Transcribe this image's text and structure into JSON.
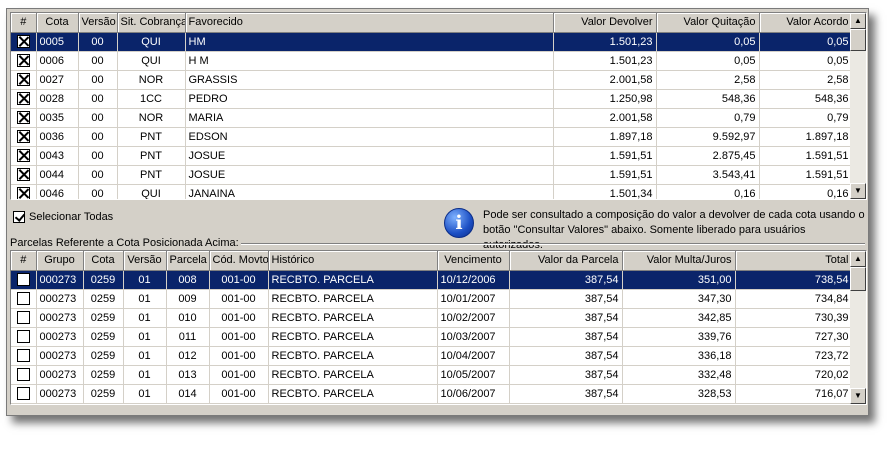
{
  "top_grid": {
    "columns": [
      "#",
      "Cota",
      "Versão",
      "Sit. Cobrança",
      "Favorecido",
      "Valor Devolver",
      "Valor Quitação",
      "Valor Acordo"
    ],
    "rows": [
      {
        "cota": "0005",
        "versao": "00",
        "sit": "QUI",
        "favorecido": "HM",
        "devolver": "1.501,23",
        "quitacao": "0,05",
        "acordo": "0,05",
        "checked": true,
        "selected": true
      },
      {
        "cota": "0006",
        "versao": "00",
        "sit": "QUI",
        "favorecido": "H M",
        "devolver": "1.501,23",
        "quitacao": "0,05",
        "acordo": "0,05",
        "checked": true
      },
      {
        "cota": "0027",
        "versao": "00",
        "sit": "NOR",
        "favorecido": "GRASSIS",
        "devolver": "2.001,58",
        "quitacao": "2,58",
        "acordo": "2,58",
        "checked": true
      },
      {
        "cota": "0028",
        "versao": "00",
        "sit": "1CC",
        "favorecido": "PEDRO",
        "devolver": "1.250,98",
        "quitacao": "548,36",
        "acordo": "548,36",
        "checked": true
      },
      {
        "cota": "0035",
        "versao": "00",
        "sit": "NOR",
        "favorecido": "MARIA",
        "devolver": "2.001,58",
        "quitacao": "0,79",
        "acordo": "0,79",
        "checked": true
      },
      {
        "cota": "0036",
        "versao": "00",
        "sit": "PNT",
        "favorecido": "EDSON",
        "devolver": "1.897,18",
        "quitacao": "9.592,97",
        "acordo": "1.897,18",
        "checked": true
      },
      {
        "cota": "0043",
        "versao": "00",
        "sit": "PNT",
        "favorecido": "JOSUE",
        "devolver": "1.591,51",
        "quitacao": "2.875,45",
        "acordo": "1.591,51",
        "checked": true
      },
      {
        "cota": "0044",
        "versao": "00",
        "sit": "PNT",
        "favorecido": "JOSUE",
        "devolver": "1.591,51",
        "quitacao": "3.543,41",
        "acordo": "1.591,51",
        "checked": true
      },
      {
        "cota": "0046",
        "versao": "00",
        "sit": "QUI",
        "favorecido": "JANAINA",
        "devolver": "1.501,34",
        "quitacao": "0,16",
        "acordo": "0,16",
        "checked": true
      }
    ]
  },
  "select_all": {
    "label": "Selecionar Todas",
    "checked": true
  },
  "info": {
    "icon": "info-icon",
    "text": "Pode ser consultado a composição do valor a devolver de cada cota usando o botão \"Consultar Valores\" abaixo. Somente liberado para usuários autorizados."
  },
  "section_label": "Parcelas Referente a Cota Posicionada Acima:",
  "bottom_grid": {
    "columns": [
      "#",
      "Grupo",
      "Cota",
      "Versão",
      "Parcela",
      "Cód. Movto",
      "Histórico",
      "Vencimento",
      "Valor da Parcela",
      "Valor Multa/Juros",
      "Total"
    ],
    "rows": [
      {
        "grupo": "000273",
        "cota": "0259",
        "versao": "01",
        "parcela": "008",
        "cod": "001-00",
        "historico": "RECBTO. PARCELA",
        "vencimento": "10/12/2006",
        "valor": "387,54",
        "multa": "351,00",
        "total": "738,54",
        "selected": true
      },
      {
        "grupo": "000273",
        "cota": "0259",
        "versao": "01",
        "parcela": "009",
        "cod": "001-00",
        "historico": "RECBTO. PARCELA",
        "vencimento": "10/01/2007",
        "valor": "387,54",
        "multa": "347,30",
        "total": "734,84"
      },
      {
        "grupo": "000273",
        "cota": "0259",
        "versao": "01",
        "parcela": "010",
        "cod": "001-00",
        "historico": "RECBTO. PARCELA",
        "vencimento": "10/02/2007",
        "valor": "387,54",
        "multa": "342,85",
        "total": "730,39"
      },
      {
        "grupo": "000273",
        "cota": "0259",
        "versao": "01",
        "parcela": "011",
        "cod": "001-00",
        "historico": "RECBTO. PARCELA",
        "vencimento": "10/03/2007",
        "valor": "387,54",
        "multa": "339,76",
        "total": "727,30"
      },
      {
        "grupo": "000273",
        "cota": "0259",
        "versao": "01",
        "parcela": "012",
        "cod": "001-00",
        "historico": "RECBTO. PARCELA",
        "vencimento": "10/04/2007",
        "valor": "387,54",
        "multa": "336,18",
        "total": "723,72"
      },
      {
        "grupo": "000273",
        "cota": "0259",
        "versao": "01",
        "parcela": "013",
        "cod": "001-00",
        "historico": "RECBTO. PARCELA",
        "vencimento": "10/05/2007",
        "valor": "387,54",
        "multa": "332,48",
        "total": "720,02"
      },
      {
        "grupo": "000273",
        "cota": "0259",
        "versao": "01",
        "parcela": "014",
        "cod": "001-00",
        "historico": "RECBTO. PARCELA",
        "vencimento": "10/06/2007",
        "valor": "387,54",
        "multa": "328,53",
        "total": "716,07"
      }
    ]
  },
  "scroll_icons": {
    "up": "arrow-up-icon",
    "down": "arrow-down-icon"
  },
  "colors": {
    "selection": "#0a246a",
    "face": "#d4d0c8"
  }
}
